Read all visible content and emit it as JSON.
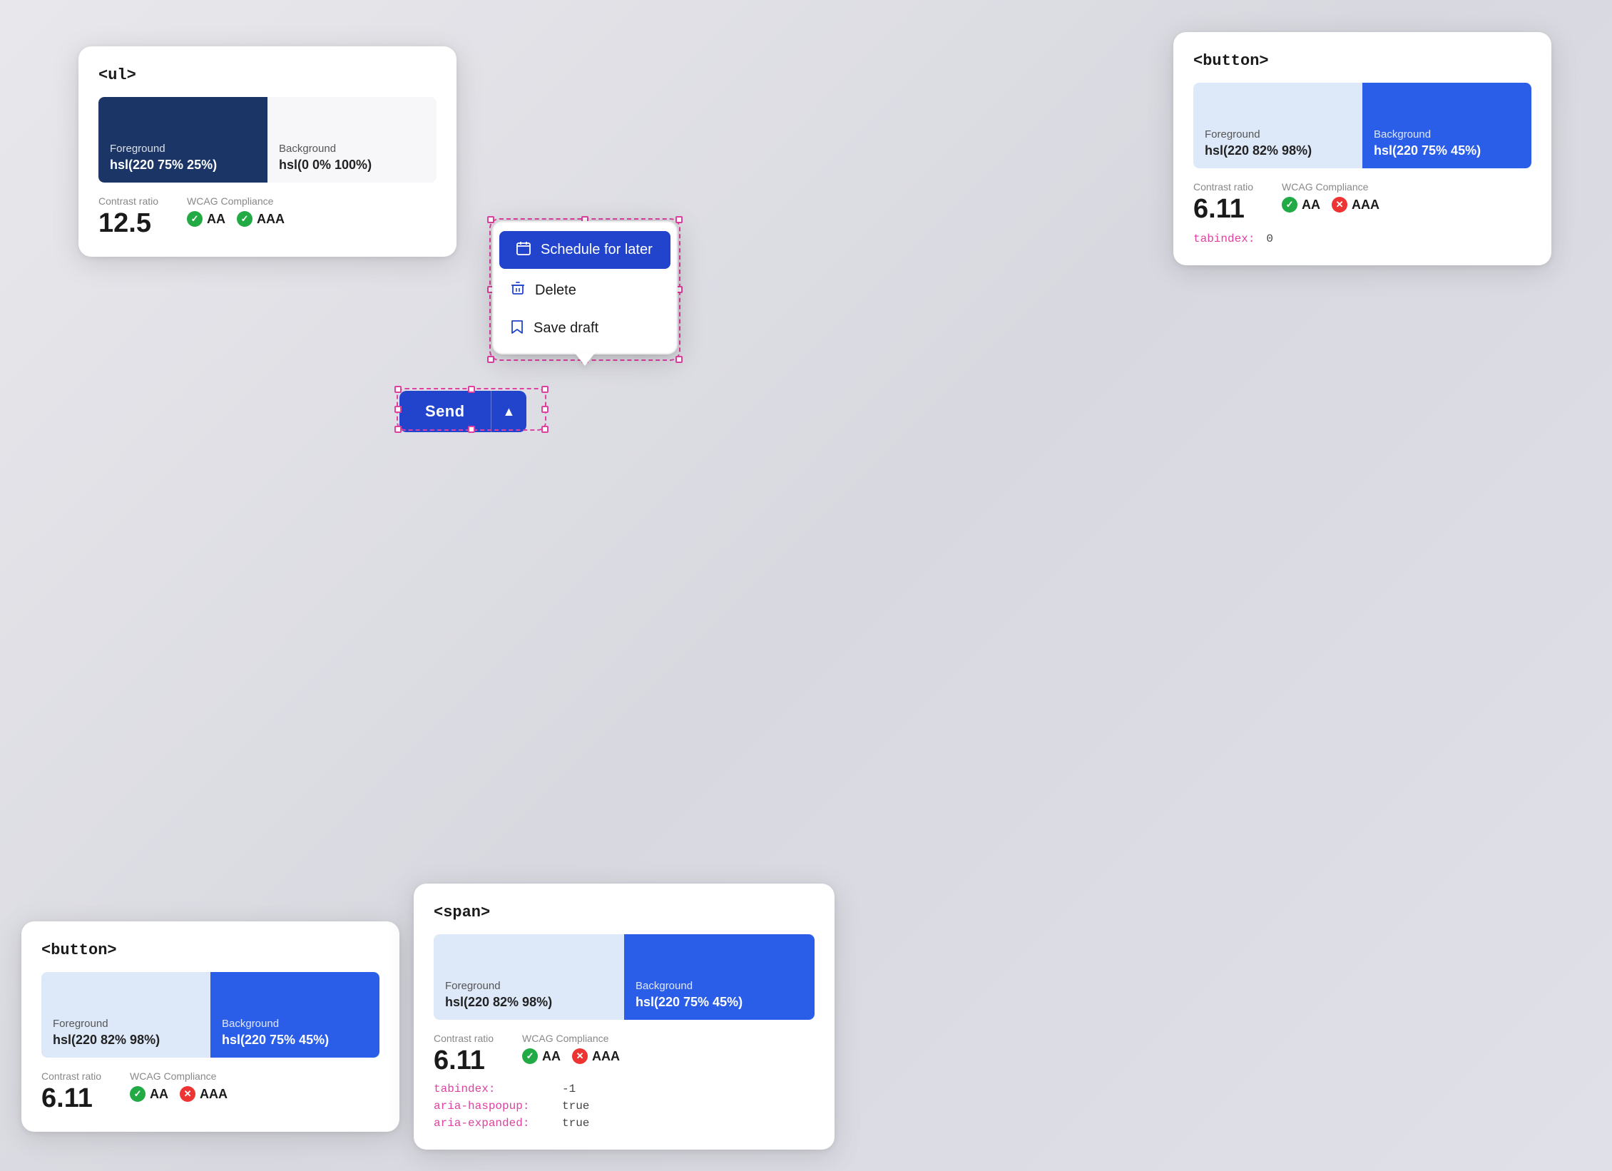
{
  "cards": {
    "ul": {
      "tag": "<ul>",
      "fg_label": "Foreground",
      "fg_value": "hsl(220 75% 25%)",
      "bg_label": "Background",
      "bg_value": "hsl(0 0% 100%)",
      "contrast_label": "Contrast ratio",
      "contrast_value": "12.5",
      "wcag_label": "WCAG Compliance",
      "aa_label": "AA",
      "aaa_label": "AAA"
    },
    "button_top": {
      "tag": "<button>",
      "fg_label": "Foreground",
      "fg_value": "hsl(220 82% 98%)",
      "bg_label": "Background",
      "bg_value": "hsl(220 75% 45%)",
      "contrast_label": "Contrast ratio",
      "contrast_value": "6.11",
      "wcag_label": "WCAG Compliance",
      "aa_label": "AA",
      "aaa_label": "AAA",
      "tabindex_label": "tabindex:",
      "tabindex_value": "0"
    },
    "button_bottom": {
      "tag": "<button>",
      "fg_label": "Foreground",
      "fg_value": "hsl(220 82% 98%)",
      "bg_label": "Background",
      "bg_value": "hsl(220 75% 45%)",
      "contrast_label": "Contrast ratio",
      "contrast_value": "6.11",
      "wcag_label": "WCAG Compliance",
      "aa_label": "AA",
      "aaa_label": "AAA"
    },
    "span": {
      "tag": "<span>",
      "fg_label": "Foreground",
      "fg_value": "hsl(220 82% 98%)",
      "bg_label": "Background",
      "bg_value": "hsl(220 75% 45%)",
      "contrast_label": "Contrast ratio",
      "contrast_value": "6.11",
      "wcag_label": "WCAG Compliance",
      "aa_label": "AA",
      "aaa_label": "AAA",
      "tabindex_label": "tabindex:",
      "tabindex_value": "-1",
      "aria_haspopup_label": "aria-haspopup:",
      "aria_haspopup_value": "true",
      "aria_expanded_label": "aria-expanded:",
      "aria_expanded_value": "true"
    }
  },
  "context_menu": {
    "items": [
      {
        "label": "Schedule for later",
        "icon": "calendar"
      },
      {
        "label": "Delete",
        "icon": "trash"
      },
      {
        "label": "Save draft",
        "icon": "bookmark"
      }
    ]
  },
  "send_button": {
    "label": "Send",
    "caret": "▲"
  },
  "colors": {
    "dark_blue": "#1a3566",
    "accent_blue": "#2b5ee8",
    "white": "#ffffff",
    "light_bg": "#dde8f8",
    "pink_outline": "#e040a0",
    "menu_active": "#2244cc"
  }
}
